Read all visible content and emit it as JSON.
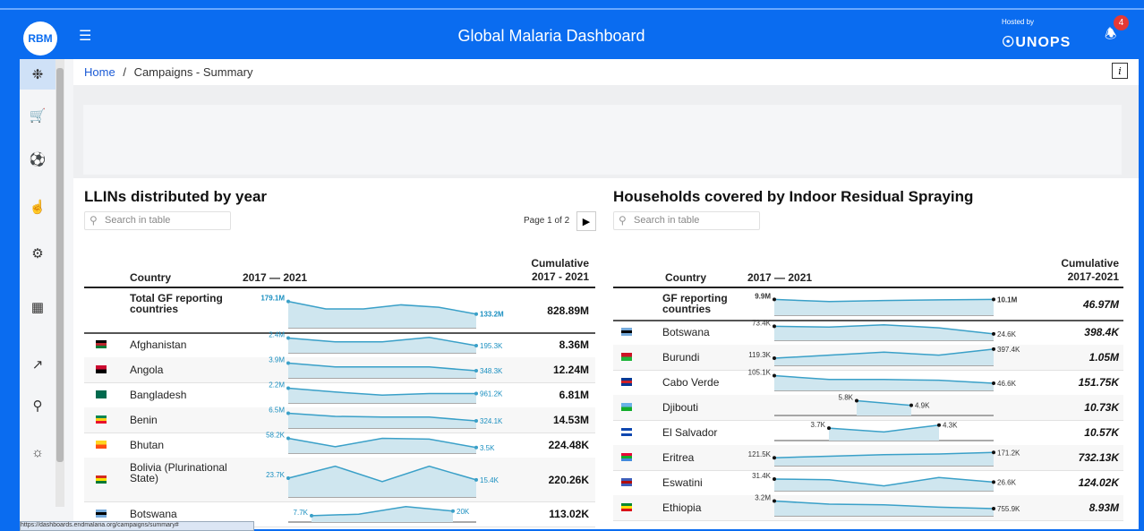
{
  "header": {
    "logo": "RBM",
    "menu_icon": "menu-icon",
    "title": "Global Malaria Dashboard",
    "hosted_by": "Hosted by",
    "host_logo": "UNOPS",
    "notification_count": "4"
  },
  "sidebar": {
    "items": [
      "mosquito-icon",
      "cart-icon",
      "bucket-icon",
      "hand-pointer-icon",
      "globe-gear-icon",
      "cash-icon",
      "line-chart-icon",
      "search-icon",
      "sun-icon"
    ]
  },
  "breadcrumb": {
    "home": "Home",
    "separator": "/",
    "current": "Campaigns - Summary"
  },
  "llin": {
    "title": "LLINs distributed by year",
    "search_placeholder": "Search in table",
    "pager": "Page 1 of 2",
    "headers": {
      "country": "Country",
      "range": "2017 — 2021",
      "cum1": "Cumulative",
      "cum2": "2017 - 2021"
    },
    "rows": [
      {
        "country": "Total GF reporting countries",
        "start": "179.1M",
        "end": "133.2M",
        "cumulative": "828.89M",
        "flag": [
          "#ffffff"
        ],
        "trend": [
          0.72,
          0.5,
          0.5,
          0.62,
          0.55,
          0.35
        ]
      },
      {
        "country": "Afghanistan",
        "start": "2.4M",
        "end": "195.3K",
        "cumulative": "8.36M",
        "flag": [
          "#000000",
          "#b8262b",
          "#007a36"
        ],
        "trend": [
          0.85,
          0.6,
          0.6,
          0.9,
          0.35
        ]
      },
      {
        "country": "Angola",
        "start": "3.9M",
        "end": "348.3K",
        "cumulative": "12.24M",
        "flag": [
          "#cc092f",
          "#000000"
        ],
        "trend": [
          0.85,
          0.6,
          0.6,
          0.6,
          0.35
        ]
      },
      {
        "country": "Bangladesh",
        "start": "2.2M",
        "end": "961.2K",
        "cumulative": "6.81M",
        "flag": [
          "#006a4e"
        ],
        "trend": [
          0.85,
          0.6,
          0.4,
          0.5,
          0.5
        ]
      },
      {
        "country": "Benin",
        "start": "6.5M",
        "end": "324.1K",
        "cumulative": "14.53M",
        "flag": [
          "#008751",
          "#fcd116",
          "#e8112d"
        ],
        "trend": [
          0.85,
          0.65,
          0.6,
          0.6,
          0.35
        ]
      },
      {
        "country": "Bhutan",
        "start": "58.2K",
        "end": "3.5K",
        "cumulative": "224.48K",
        "flag": [
          "#ffd520",
          "#ff4e12"
        ],
        "trend": [
          0.85,
          0.3,
          0.85,
          0.8,
          0.25
        ]
      },
      {
        "country": "Bolivia (Plurinational State)",
        "start": "23.7K",
        "end": "15.4K",
        "cumulative": "220.26K",
        "flag": [
          "#d52b1e",
          "#f9e300",
          "#007934"
        ],
        "trend": [
          0.5,
          0.85,
          0.4,
          0.85,
          0.45
        ]
      },
      {
        "country": "Botswana",
        "start": "7.7K",
        "end": "20K",
        "cumulative": "113.02K",
        "flag": [
          "#75aadb",
          "#000000",
          "#75aadb"
        ],
        "trend": [
          0.3,
          0.4,
          0.9,
          0.6
        ]
      }
    ]
  },
  "irs": {
    "title": "Households covered by Indoor Residual Spraying",
    "search_placeholder": "Search in table",
    "headers": {
      "country": "Country",
      "range": "2017 — 2021",
      "cum1": "Cumulative",
      "cum2": "2017-2021"
    },
    "rows": [
      {
        "country": "GF reporting countries",
        "start": "9.9M",
        "end": "10.1M",
        "cumulative": "46.97M",
        "flag": [
          "#ffffff"
        ],
        "trend": [
          0.65,
          0.55,
          0.6,
          0.63,
          0.65
        ]
      },
      {
        "country": "Botswana",
        "start": "73.4K",
        "end": "24.6K",
        "cumulative": "398.4K",
        "flag": [
          "#75aadb",
          "#000000",
          "#75aadb"
        ],
        "trend": [
          0.8,
          0.75,
          0.9,
          0.7,
          0.3
        ]
      },
      {
        "country": "Burundi",
        "start": "119.3K",
        "end": "397.4K",
        "cumulative": "1.05M",
        "flag": [
          "#ce1126",
          "#1eb53a"
        ],
        "trend": [
          0.35,
          0.55,
          0.75,
          0.55,
          0.95
        ]
      },
      {
        "country": "Cabo Verde",
        "start": "105.1K",
        "end": "46.6K",
        "cumulative": "151.75K",
        "flag": [
          "#003893",
          "#cf2027",
          "#003893"
        ],
        "trend": [
          0.85,
          0.6,
          0.6,
          0.55,
          0.35
        ]
      },
      {
        "country": "Djibouti",
        "start": "5.8K",
        "end": "4.9K",
        "cumulative": "10.73K",
        "flag": [
          "#6ab2e7",
          "#12ad2b"
        ],
        "trend": [
          0.85,
          0.55
        ]
      },
      {
        "country": "El Salvador",
        "start": "3.7K",
        "end": "4.3K",
        "cumulative": "10.57K",
        "flag": [
          "#0f47af",
          "#ffffff",
          "#0f47af"
        ],
        "trend": [
          0.7,
          0.45,
          0.9
        ]
      },
      {
        "country": "Eritrea",
        "start": "121.5K",
        "end": "171.2K",
        "cumulative": "732.13K",
        "flag": [
          "#ea0437",
          "#12ad2b",
          "#4189dd"
        ],
        "trend": [
          0.4,
          0.5,
          0.6,
          0.65,
          0.75
        ]
      },
      {
        "country": "Eswatini",
        "start": "31.4K",
        "end": "26.6K",
        "cumulative": "124.02K",
        "flag": [
          "#3e5eb9",
          "#b10c0c",
          "#3e5eb9"
        ],
        "trend": [
          0.65,
          0.6,
          0.2,
          0.75,
          0.45
        ]
      },
      {
        "country": "Ethiopia",
        "start": "3.2M",
        "end": "755.9K",
        "cumulative": "8.93M",
        "flag": [
          "#078930",
          "#fcdd09",
          "#da121a"
        ],
        "trend": [
          0.85,
          0.65,
          0.6,
          0.45,
          0.35
        ]
      }
    ]
  },
  "status_url": "https://dashboards.endmalaria.org/campaigns/summary#"
}
